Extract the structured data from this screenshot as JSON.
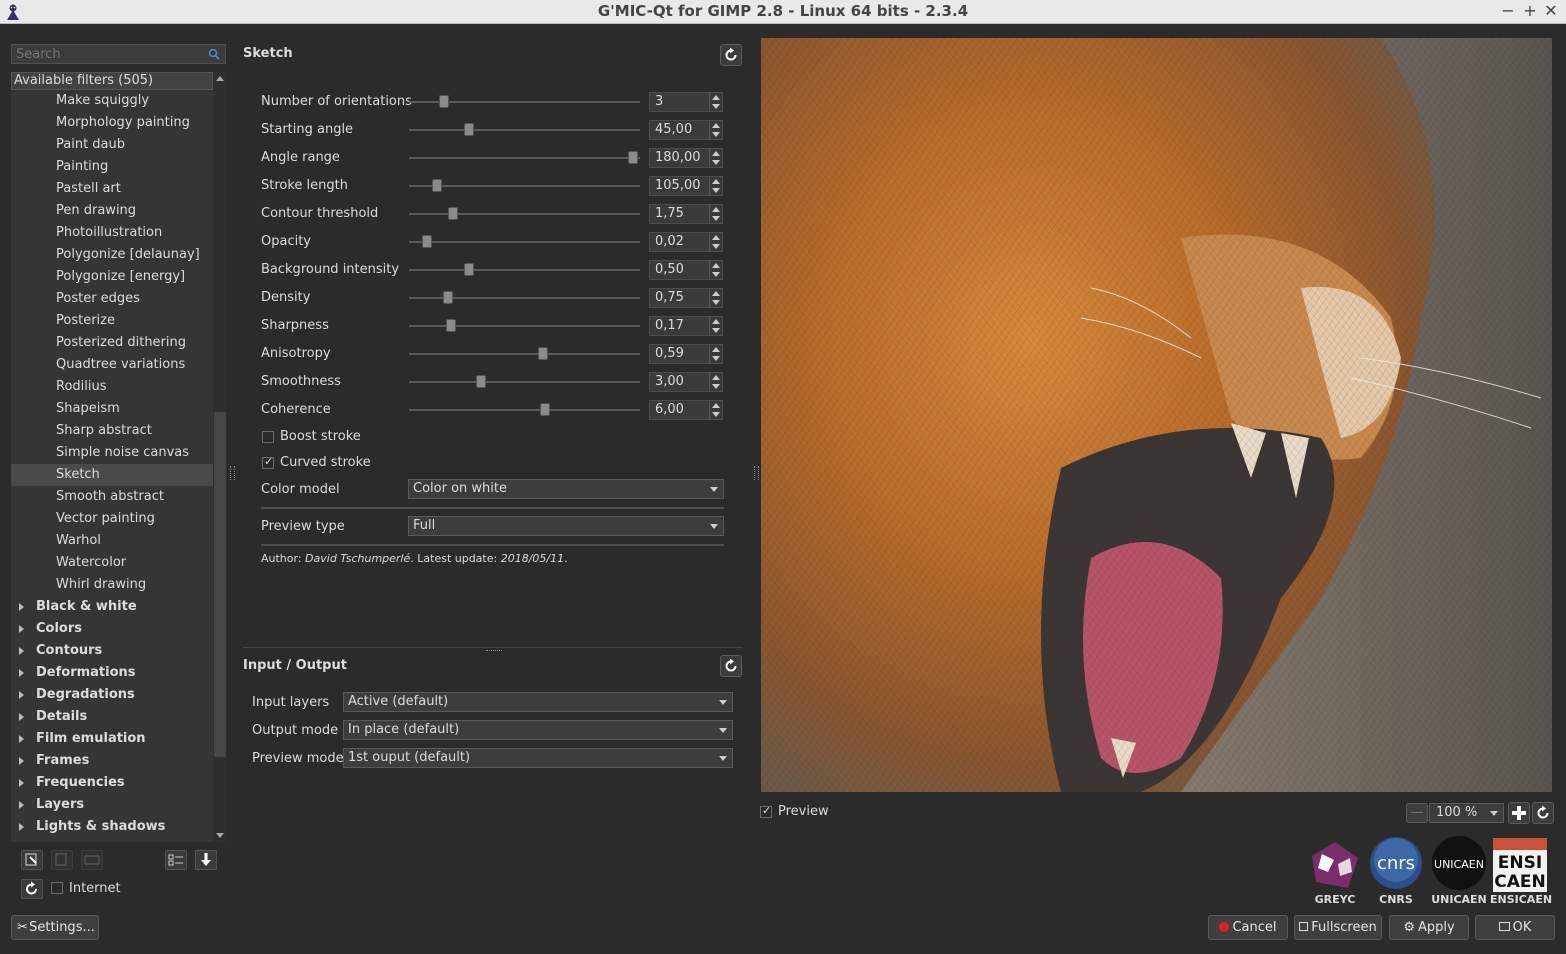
{
  "window": {
    "title": "G'MIC-Qt for GIMP 2.8 - Linux 64 bits - 2.3.4",
    "controls": [
      "−",
      "+",
      "✕"
    ]
  },
  "search": {
    "placeholder": "Search"
  },
  "filters": {
    "header": "Available filters (505)",
    "items": [
      "Make squiggly",
      "Morphology painting",
      "Paint daub",
      "Painting",
      "Pastell art",
      "Pen drawing",
      "Photoillustration",
      "Polygonize [delaunay]",
      "Polygonize [energy]",
      "Poster edges",
      "Posterize",
      "Posterized dithering",
      "Quadtree variations",
      "Rodilius",
      "Shapeism",
      "Sharp abstract",
      "Simple noise canvas",
      "Sketch",
      "Smooth abstract",
      "Vector painting",
      "Warhol",
      "Watercolor",
      "Whirl drawing"
    ],
    "selected": "Sketch",
    "categories": [
      "Black & white",
      "Colors",
      "Contours",
      "Deformations",
      "Degradations",
      "Details",
      "Film emulation",
      "Frames",
      "Frequencies",
      "Layers",
      "Lights & shadows"
    ]
  },
  "bottom_left": {
    "internet_label": "Internet",
    "internet_checked": false,
    "settings_label": "Settings..."
  },
  "filter": {
    "name": "Sketch",
    "params": [
      {
        "label": "Number of orientations",
        "value": "3",
        "fraction": 0.15
      },
      {
        "label": "Starting angle",
        "value": "45,00",
        "fraction": 0.26
      },
      {
        "label": "Angle range",
        "value": "180,00",
        "fraction": 0.97
      },
      {
        "label": "Stroke length",
        "value": "105,00",
        "fraction": 0.12
      },
      {
        "label": "Contour threshold",
        "value": "1,75",
        "fraction": 0.19
      },
      {
        "label": "Opacity",
        "value": "0,02",
        "fraction": 0.08
      },
      {
        "label": "Background intensity",
        "value": "0,50",
        "fraction": 0.26
      },
      {
        "label": "Density",
        "value": "0,75",
        "fraction": 0.17
      },
      {
        "label": "Sharpness",
        "value": "0,17",
        "fraction": 0.18
      },
      {
        "label": "Anisotropy",
        "value": "0,59",
        "fraction": 0.58
      },
      {
        "label": "Smoothness",
        "value": "3,00",
        "fraction": 0.31
      },
      {
        "label": "Coherence",
        "value": "6,00",
        "fraction": 0.59
      }
    ],
    "boost_stroke": {
      "label": "Boost stroke",
      "checked": false
    },
    "curved_stroke": {
      "label": "Curved stroke",
      "checked": true
    },
    "color_model": {
      "label": "Color model",
      "value": "Color on white"
    },
    "preview_type": {
      "label": "Preview type",
      "value": "Full"
    },
    "author_prefix": "Author: ",
    "author_name": "David Tschumperlé",
    "update_prefix": ". Latest update: ",
    "update_date": "2018/05/11",
    "update_suffix": "."
  },
  "io": {
    "title": "Input / Output",
    "input_layers": {
      "label": "Input layers",
      "value": "Active (default)"
    },
    "output_mode": {
      "label": "Output mode",
      "value": "In place (default)"
    },
    "preview_mode": {
      "label": "Preview mode",
      "value": "1st ouput (default)"
    }
  },
  "preview": {
    "checkbox_label": "Preview",
    "checked": true,
    "zoom": "100 %"
  },
  "logos": [
    "GREYC",
    "CNRS",
    "UNICAEN",
    "ENSICAEN"
  ],
  "logo_marks": {
    "cnrs": "cnrs",
    "unicaen": "UNICAEN",
    "ensi": "ENSI",
    "caen": "CAEN"
  },
  "buttons": {
    "cancel": "Cancel",
    "fullscreen": "Fullscreen",
    "apply": "Apply",
    "ok": "OK"
  }
}
